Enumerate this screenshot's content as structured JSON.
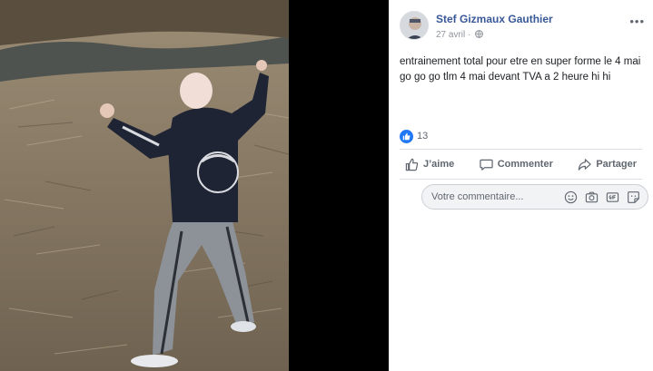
{
  "post": {
    "author": "Stef Gizmaux Gauthier",
    "date": "27 avril",
    "date_separator": "·",
    "text": "entrainement total pour etre en super forme le 4 mai go go go tlm 4 mai devant TVA a 2 heure hi hi",
    "reaction_count": "13"
  },
  "actions": {
    "like_label": "J’aime",
    "comment_label": "Commenter",
    "share_label": "Partager"
  },
  "comment_box": {
    "placeholder": "Votre commentaire..."
  },
  "colors": {
    "author_link": "#385898",
    "like_blue": "#2078f4",
    "muted_text": "#606770"
  },
  "icons": [
    "globe-icon",
    "more-icon",
    "like-reaction-icon",
    "thumbs-up-icon",
    "comment-icon",
    "share-icon",
    "emoji-icon",
    "camera-icon",
    "gif-icon",
    "sticker-icon"
  ]
}
